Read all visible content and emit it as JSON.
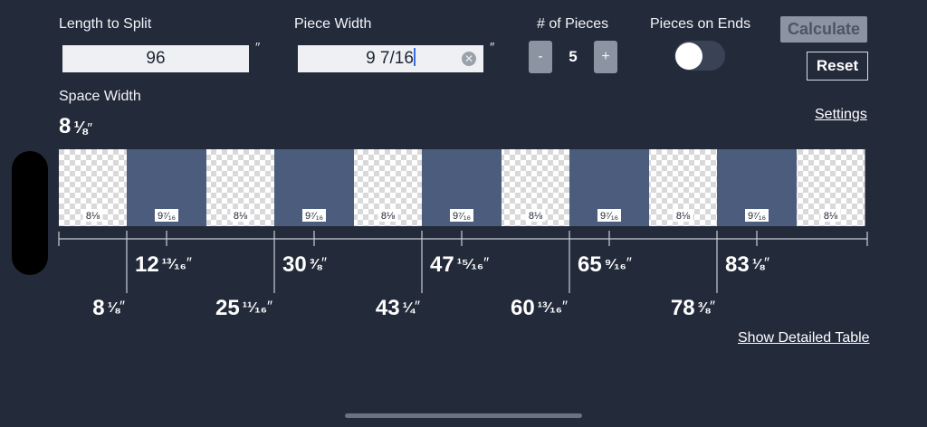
{
  "inputs": {
    "length_label": "Length to Split",
    "length_value": "96",
    "piece_width_label": "Piece Width",
    "piece_width_value": "9 7/16",
    "unit_symbol": "″"
  },
  "pieces": {
    "label": "# of Pieces",
    "minus_label": "-",
    "count": "5",
    "plus_label": "+"
  },
  "ends": {
    "label": "Pieces on Ends",
    "on": false
  },
  "buttons": {
    "calculate": "Calculate",
    "reset": "Reset"
  },
  "space": {
    "label": "Space Width",
    "whole": "8",
    "frac": "⅛",
    "unit": "″"
  },
  "links": {
    "settings": "Settings",
    "detailed_table": "Show Detailed Table"
  },
  "strip": [
    {
      "kind": "space",
      "label": "8⅛"
    },
    {
      "kind": "piece",
      "label": "9⁷⁄₁₆"
    },
    {
      "kind": "space",
      "label": "8⅛"
    },
    {
      "kind": "piece",
      "label": "9⁷⁄₁₆"
    },
    {
      "kind": "space",
      "label": "8⅛"
    },
    {
      "kind": "piece",
      "label": "9⁷⁄₁₆"
    },
    {
      "kind": "space",
      "label": "8⅛"
    },
    {
      "kind": "piece",
      "label": "9⁷⁄₁₆"
    },
    {
      "kind": "space",
      "label": "8⅛"
    },
    {
      "kind": "piece",
      "label": "9⁷⁄₁₆"
    },
    {
      "kind": "space",
      "label": "8⅛"
    }
  ],
  "centers": [
    {
      "whole": "12",
      "frac": "¹³⁄₁₆",
      "unit": "″"
    },
    {
      "whole": "30",
      "frac": "⅜",
      "unit": "″"
    },
    {
      "whole": "47",
      "frac": "¹⁵⁄₁₆",
      "unit": "″"
    },
    {
      "whole": "65",
      "frac": "⁹⁄₁₆",
      "unit": "″"
    },
    {
      "whole": "83",
      "frac": "⅛",
      "unit": "″"
    }
  ],
  "edges": [
    {
      "whole": "8",
      "frac": "⅛",
      "unit": "″"
    },
    {
      "whole": "25",
      "frac": "¹¹⁄₁₆",
      "unit": "″"
    },
    {
      "whole": "43",
      "frac": "¼",
      "unit": "″"
    },
    {
      "whole": "60",
      "frac": "¹³⁄₁₆",
      "unit": "″"
    },
    {
      "whole": "78",
      "frac": "⅜",
      "unit": "″"
    }
  ],
  "colors": {
    "background": "#232a3a",
    "piece": "#4b5c7c",
    "checker_light": "#ffffff",
    "checker_dark": "#d9d9d9"
  }
}
